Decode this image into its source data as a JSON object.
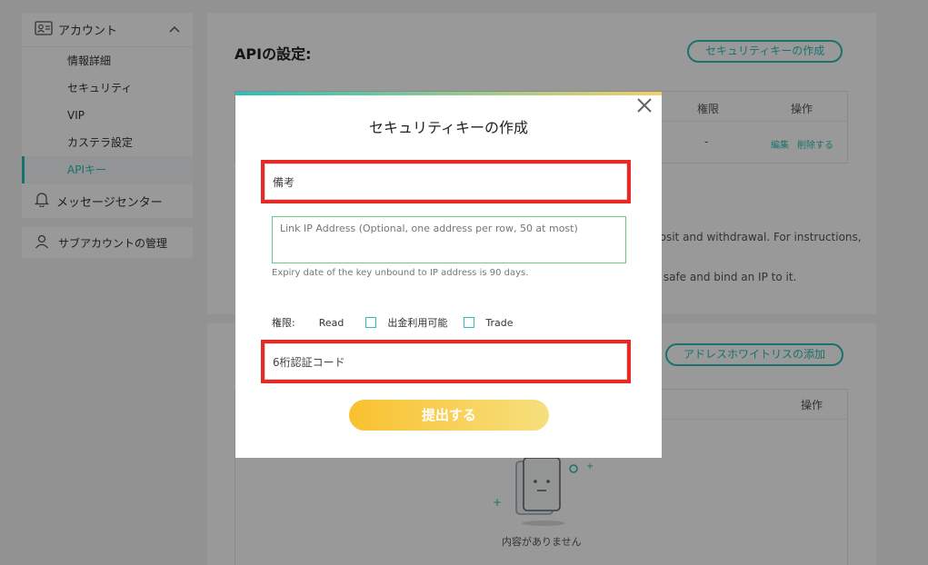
{
  "sidebar": {
    "account_label": "アカウント",
    "items": [
      {
        "label": "情報詳細"
      },
      {
        "label": "セキュリティ"
      },
      {
        "label": "VIP"
      },
      {
        "label": "カステラ設定"
      },
      {
        "label": "APIキー"
      }
    ],
    "message_center": "メッセージセンター",
    "subaccount": "サブアカウントの管理"
  },
  "api_card": {
    "title": "APIの設定:",
    "create_button": "セキュリティキーの作成",
    "col_permission": "権限",
    "col_action": "操作",
    "row_permission": "-",
    "row_edit": "編集",
    "row_delete": "削除する",
    "text_line1": "posit and withdrawal. For instructions,",
    "text_line2": "it safe and bind an IP to it."
  },
  "address_card": {
    "add_button": "アドレスホワイトリスの添加",
    "col_action": "操作",
    "empty_text": "内容がありません"
  },
  "modal": {
    "title": "セキュリティキーの作成",
    "memo_placeholder": "備考",
    "ip_placeholder": "Link IP Address (Optional, one address per row, 50 at most)",
    "expiry_note": "Expiry date of the key unbound to IP address is 90 days.",
    "perm_label": "権限:",
    "perm_read": "Read",
    "perm_withdraw": "出金利用可能",
    "perm_trade": "Trade",
    "code_placeholder": "6桁認証コード",
    "submit_label": "提出する"
  },
  "colors": {
    "accent": "#2bbfb8",
    "highlight": "#e62a26",
    "submit": "#f9c12f"
  }
}
